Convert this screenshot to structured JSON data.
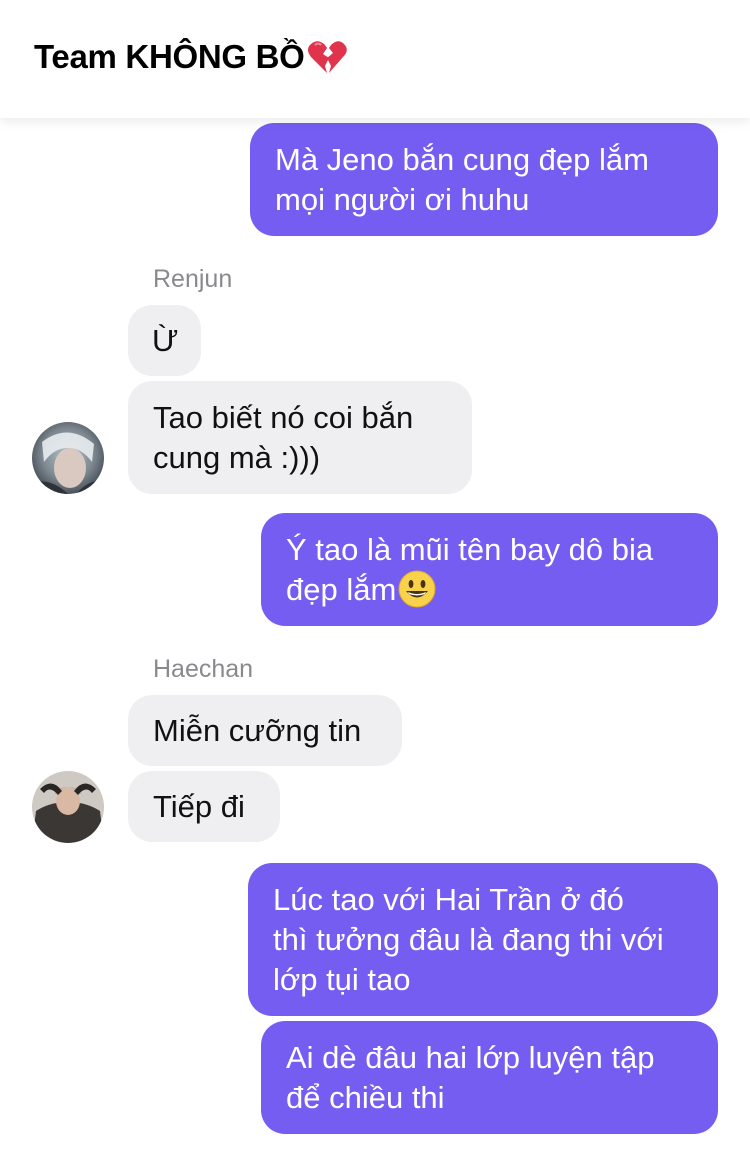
{
  "header": {
    "title": "Team KHÔNG BỒ",
    "title_icon": "broken-heart-icon"
  },
  "messages": [
    {
      "side": "out",
      "text": "Mà Jeno bắn cung đẹp lắm\nmọi người ơi huhu"
    },
    {
      "side": "in",
      "sender": "Renjun",
      "text": "Ừ"
    },
    {
      "side": "in",
      "sender": "Renjun",
      "text": "Tao biết nó coi bắn\ncung mà :)))"
    },
    {
      "side": "out",
      "text": "Ý tao là mũi tên bay dô bia\nđẹp lắm",
      "emoji": "grinning-face-icon"
    },
    {
      "side": "in",
      "sender": "Haechan",
      "text": "Miễn cưỡng tin"
    },
    {
      "side": "in",
      "sender": "Haechan",
      "text": "Tiếp đi"
    },
    {
      "side": "out",
      "text": "Lúc tao với Hai Trần ở đó\nthì tưởng đâu là đang thi với\nlớp tụi tao"
    },
    {
      "side": "out",
      "text": "Ai dè đâu hai lớp luyện tập\nđể chiều thi"
    }
  ],
  "senders": {
    "renjun": "Renjun",
    "haechan": "Haechan"
  },
  "colors": {
    "outgoing_bubble": "#765df2",
    "incoming_bubble": "#efeff1",
    "sender_name": "#8a8a8e"
  }
}
